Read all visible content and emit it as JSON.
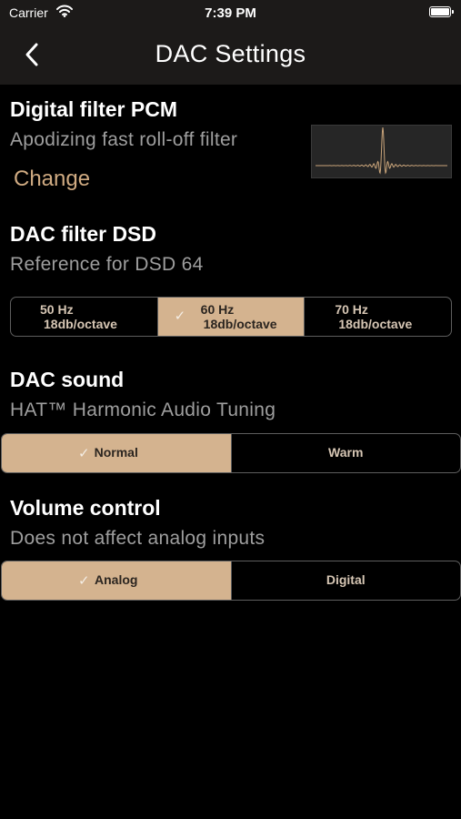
{
  "status_bar": {
    "carrier": "Carrier",
    "time": "7:39 PM"
  },
  "nav": {
    "title": "DAC Settings"
  },
  "digital_filter": {
    "heading": "Digital filter PCM",
    "subtitle": "Apodizing fast roll-off filter",
    "change_label": "Change"
  },
  "dsd_filter": {
    "heading": "DAC filter DSD",
    "subtitle": "Reference for DSD 64",
    "options": [
      {
        "freq": "50 Hz",
        "slope": "18db/octave",
        "selected": false
      },
      {
        "freq": "60 Hz",
        "slope": "18db/octave",
        "selected": true
      },
      {
        "freq": "70 Hz",
        "slope": "18db/octave",
        "selected": false
      }
    ]
  },
  "dac_sound": {
    "heading": "DAC sound",
    "subtitle": "HAT™ Harmonic Audio Tuning",
    "options": [
      {
        "label": "Normal",
        "selected": true
      },
      {
        "label": "Warm",
        "selected": false
      }
    ]
  },
  "volume_control": {
    "heading": "Volume control",
    "subtitle": "Does not affect analog inputs",
    "options": [
      {
        "label": "Analog",
        "selected": true
      },
      {
        "label": "Digital",
        "selected": false
      }
    ]
  },
  "colors": {
    "accent": "#d4b38f",
    "accent_text": "#d0ab82",
    "background": "#000000",
    "bar": "#1c1a19"
  },
  "icons": {
    "selected_mark": "✓",
    "back": "chevron-left-icon",
    "wifi": "wifi-icon",
    "battery": "battery-icon"
  }
}
